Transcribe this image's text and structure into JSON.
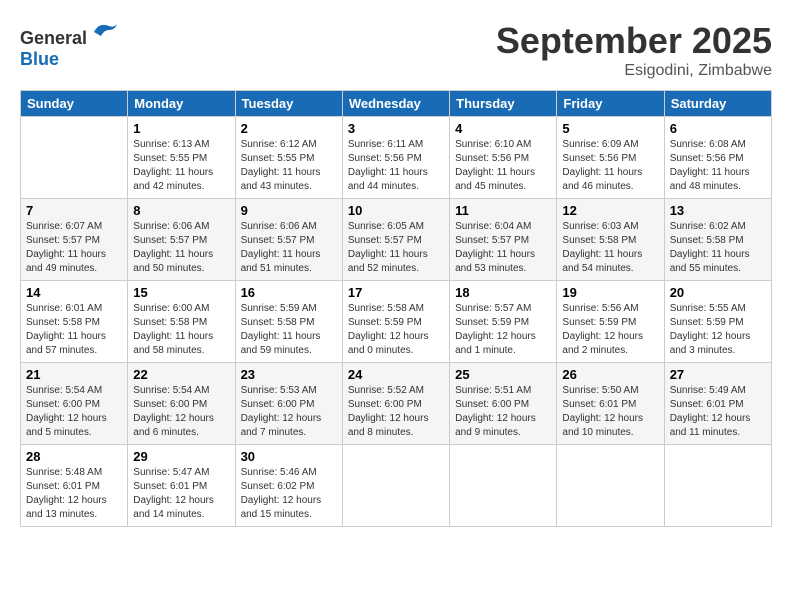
{
  "header": {
    "logo_general": "General",
    "logo_blue": "Blue",
    "month_title": "September 2025",
    "location": "Esigodini, Zimbabwe"
  },
  "days_of_week": [
    "Sunday",
    "Monday",
    "Tuesday",
    "Wednesday",
    "Thursday",
    "Friday",
    "Saturday"
  ],
  "weeks": [
    [
      {
        "day": "",
        "info": ""
      },
      {
        "day": "1",
        "info": "Sunrise: 6:13 AM\nSunset: 5:55 PM\nDaylight: 11 hours\nand 42 minutes."
      },
      {
        "day": "2",
        "info": "Sunrise: 6:12 AM\nSunset: 5:55 PM\nDaylight: 11 hours\nand 43 minutes."
      },
      {
        "day": "3",
        "info": "Sunrise: 6:11 AM\nSunset: 5:56 PM\nDaylight: 11 hours\nand 44 minutes."
      },
      {
        "day": "4",
        "info": "Sunrise: 6:10 AM\nSunset: 5:56 PM\nDaylight: 11 hours\nand 45 minutes."
      },
      {
        "day": "5",
        "info": "Sunrise: 6:09 AM\nSunset: 5:56 PM\nDaylight: 11 hours\nand 46 minutes."
      },
      {
        "day": "6",
        "info": "Sunrise: 6:08 AM\nSunset: 5:56 PM\nDaylight: 11 hours\nand 48 minutes."
      }
    ],
    [
      {
        "day": "7",
        "info": "Sunrise: 6:07 AM\nSunset: 5:57 PM\nDaylight: 11 hours\nand 49 minutes."
      },
      {
        "day": "8",
        "info": "Sunrise: 6:06 AM\nSunset: 5:57 PM\nDaylight: 11 hours\nand 50 minutes."
      },
      {
        "day": "9",
        "info": "Sunrise: 6:06 AM\nSunset: 5:57 PM\nDaylight: 11 hours\nand 51 minutes."
      },
      {
        "day": "10",
        "info": "Sunrise: 6:05 AM\nSunset: 5:57 PM\nDaylight: 11 hours\nand 52 minutes."
      },
      {
        "day": "11",
        "info": "Sunrise: 6:04 AM\nSunset: 5:57 PM\nDaylight: 11 hours\nand 53 minutes."
      },
      {
        "day": "12",
        "info": "Sunrise: 6:03 AM\nSunset: 5:58 PM\nDaylight: 11 hours\nand 54 minutes."
      },
      {
        "day": "13",
        "info": "Sunrise: 6:02 AM\nSunset: 5:58 PM\nDaylight: 11 hours\nand 55 minutes."
      }
    ],
    [
      {
        "day": "14",
        "info": "Sunrise: 6:01 AM\nSunset: 5:58 PM\nDaylight: 11 hours\nand 57 minutes."
      },
      {
        "day": "15",
        "info": "Sunrise: 6:00 AM\nSunset: 5:58 PM\nDaylight: 11 hours\nand 58 minutes."
      },
      {
        "day": "16",
        "info": "Sunrise: 5:59 AM\nSunset: 5:58 PM\nDaylight: 11 hours\nand 59 minutes."
      },
      {
        "day": "17",
        "info": "Sunrise: 5:58 AM\nSunset: 5:59 PM\nDaylight: 12 hours\nand 0 minutes."
      },
      {
        "day": "18",
        "info": "Sunrise: 5:57 AM\nSunset: 5:59 PM\nDaylight: 12 hours\nand 1 minute."
      },
      {
        "day": "19",
        "info": "Sunrise: 5:56 AM\nSunset: 5:59 PM\nDaylight: 12 hours\nand 2 minutes."
      },
      {
        "day": "20",
        "info": "Sunrise: 5:55 AM\nSunset: 5:59 PM\nDaylight: 12 hours\nand 3 minutes."
      }
    ],
    [
      {
        "day": "21",
        "info": "Sunrise: 5:54 AM\nSunset: 6:00 PM\nDaylight: 12 hours\nand 5 minutes."
      },
      {
        "day": "22",
        "info": "Sunrise: 5:54 AM\nSunset: 6:00 PM\nDaylight: 12 hours\nand 6 minutes."
      },
      {
        "day": "23",
        "info": "Sunrise: 5:53 AM\nSunset: 6:00 PM\nDaylight: 12 hours\nand 7 minutes."
      },
      {
        "day": "24",
        "info": "Sunrise: 5:52 AM\nSunset: 6:00 PM\nDaylight: 12 hours\nand 8 minutes."
      },
      {
        "day": "25",
        "info": "Sunrise: 5:51 AM\nSunset: 6:00 PM\nDaylight: 12 hours\nand 9 minutes."
      },
      {
        "day": "26",
        "info": "Sunrise: 5:50 AM\nSunset: 6:01 PM\nDaylight: 12 hours\nand 10 minutes."
      },
      {
        "day": "27",
        "info": "Sunrise: 5:49 AM\nSunset: 6:01 PM\nDaylight: 12 hours\nand 11 minutes."
      }
    ],
    [
      {
        "day": "28",
        "info": "Sunrise: 5:48 AM\nSunset: 6:01 PM\nDaylight: 12 hours\nand 13 minutes."
      },
      {
        "day": "29",
        "info": "Sunrise: 5:47 AM\nSunset: 6:01 PM\nDaylight: 12 hours\nand 14 minutes."
      },
      {
        "day": "30",
        "info": "Sunrise: 5:46 AM\nSunset: 6:02 PM\nDaylight: 12 hours\nand 15 minutes."
      },
      {
        "day": "",
        "info": ""
      },
      {
        "day": "",
        "info": ""
      },
      {
        "day": "",
        "info": ""
      },
      {
        "day": "",
        "info": ""
      }
    ]
  ]
}
